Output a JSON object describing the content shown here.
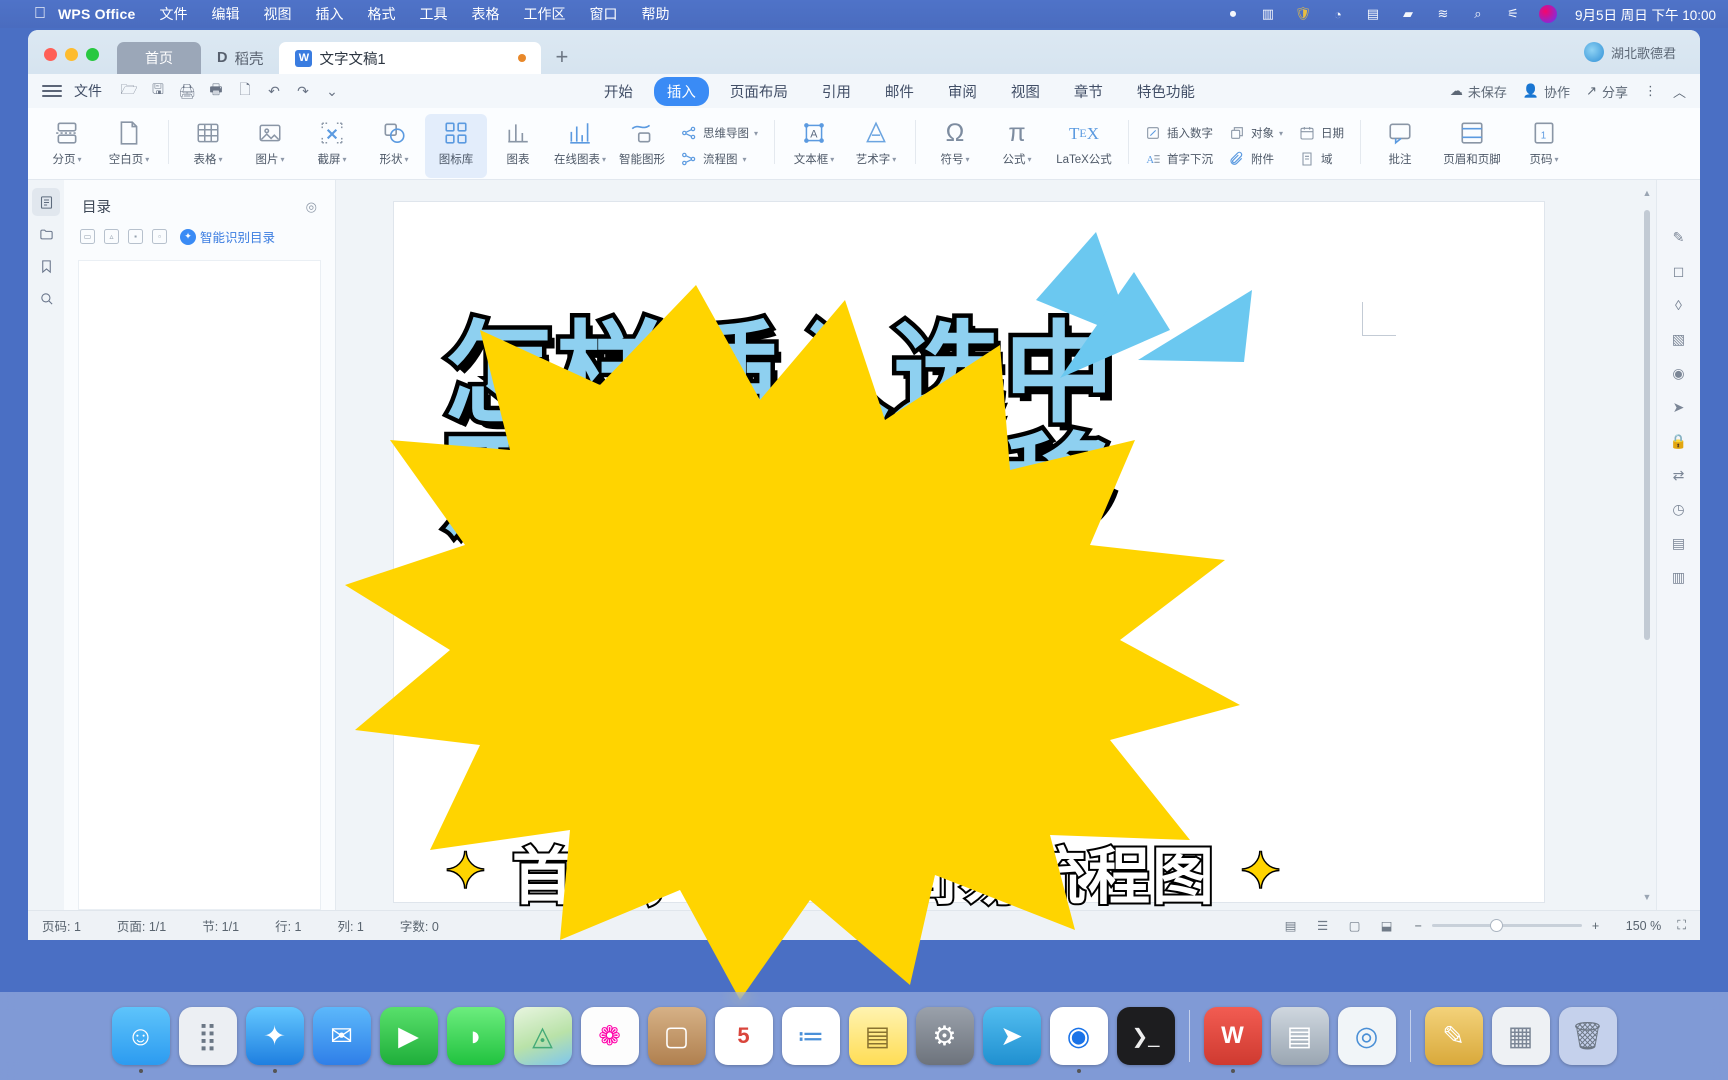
{
  "mac_menu": {
    "apple": "",
    "items": [
      "WPS Office",
      "文件",
      "编辑",
      "视图",
      "插入",
      "格式",
      "工具",
      "表格",
      "工作区",
      "窗口",
      "帮助"
    ],
    "status_icons": [
      "record-icon",
      "screen-icon",
      "shield-icon",
      "clock-icon",
      "book-icon",
      "battery-icon",
      "wifi-icon",
      "search-icon",
      "control-center-icon",
      "siri-icon"
    ],
    "clock": "9月5日 周日 下午 10:00"
  },
  "window": {
    "tabs": [
      {
        "label": "首页",
        "name": "tab-home"
      },
      {
        "label": "稻壳",
        "name": "tab-docer"
      },
      {
        "label": "文字文稿1",
        "name": "tab-document"
      }
    ],
    "new_tab": "+",
    "account": "湖北歌德君"
  },
  "ribbon": {
    "quick_access": [
      "open-icon",
      "save-icon",
      "print-icon",
      "print-preview-icon",
      "export-pdf-icon",
      "undo-icon",
      "redo-icon",
      "more-icon"
    ],
    "file_label": "文件",
    "tabs": [
      {
        "label": "开始",
        "active": false
      },
      {
        "label": "插入",
        "active": true
      },
      {
        "label": "页面布局",
        "active": false
      },
      {
        "label": "引用",
        "active": false
      },
      {
        "label": "邮件",
        "active": false
      },
      {
        "label": "审阅",
        "active": false
      },
      {
        "label": "视图",
        "active": false
      },
      {
        "label": "章节",
        "active": false
      },
      {
        "label": "特色功能",
        "active": false
      }
    ],
    "right_items": [
      {
        "label": "未保存",
        "icon": "cloud-icon"
      },
      {
        "label": "协作",
        "icon": "collab-icon"
      },
      {
        "label": "分享",
        "icon": "share-icon"
      }
    ],
    "more_label": "⋮",
    "collapse_label": "︿",
    "groups": [
      {
        "name": "pages",
        "buttons": [
          {
            "label": "分页",
            "icon": "page-break-icon",
            "caret": true
          },
          {
            "label": "空白页",
            "icon": "blank-page-icon",
            "caret": true
          }
        ]
      },
      {
        "name": "illustrations",
        "buttons": [
          {
            "label": "表格",
            "icon": "table-icon",
            "caret": true
          },
          {
            "label": "图片",
            "icon": "picture-icon",
            "caret": true
          },
          {
            "label": "截屏",
            "icon": "screenshot-icon",
            "caret": true
          },
          {
            "label": "形状",
            "icon": "shapes-icon",
            "caret": true
          },
          {
            "label": "图标库",
            "icon": "icon-library-icon",
            "selected": true
          },
          {
            "label": "图表",
            "icon": "chart-icon"
          },
          {
            "label": "在线图表",
            "icon": "online-chart-icon",
            "caret": true
          },
          {
            "label": "智能图形",
            "icon": "smart-graphic-icon"
          }
        ]
      },
      {
        "name": "diagrams",
        "stacked": [
          {
            "label": "思维导图",
            "icon": "mindmap-icon",
            "caret": true
          },
          {
            "label": "流程图",
            "icon": "flowchart-icon",
            "caret": true
          }
        ]
      },
      {
        "name": "text",
        "buttons": [
          {
            "label": "文本框",
            "icon": "textbox-icon",
            "caret": true
          },
          {
            "label": "艺术字",
            "icon": "wordart-icon",
            "caret": true
          }
        ]
      },
      {
        "name": "symbols",
        "buttons": [
          {
            "label": "符号",
            "icon": "omega-icon",
            "caret": true
          },
          {
            "label": "公式",
            "icon": "pi-icon",
            "caret": true
          },
          {
            "label": "LaTeX公式",
            "icon": "latex-icon"
          }
        ]
      },
      {
        "name": "insert-misc",
        "stacked": [
          {
            "label": "插入数字",
            "icon": "insert-number-icon"
          },
          {
            "label": "首字下沉",
            "icon": "drop-cap-icon"
          }
        ]
      },
      {
        "name": "object",
        "stacked": [
          {
            "label": "对象",
            "icon": "object-icon",
            "caret": true
          },
          {
            "label": "附件",
            "icon": "attachment-icon"
          }
        ]
      },
      {
        "name": "date-field",
        "stacked": [
          {
            "label": "日期",
            "icon": "date-icon"
          },
          {
            "label": "域",
            "icon": "field-icon"
          }
        ]
      },
      {
        "name": "comment",
        "buttons": [
          {
            "label": "批注",
            "icon": "comment-icon"
          },
          {
            "label": "页眉和页脚",
            "icon": "header-footer-icon"
          },
          {
            "label": "页码",
            "icon": "page-number-icon",
            "caret": true
          }
        ]
      }
    ]
  },
  "left_rail": [
    {
      "icon": "outline-icon",
      "name": "rail-outline",
      "selected": true
    },
    {
      "icon": "folder-icon",
      "name": "rail-folder",
      "selected": false
    },
    {
      "icon": "bookmark-icon",
      "name": "rail-bookmark",
      "selected": false
    },
    {
      "icon": "search-icon",
      "name": "rail-search",
      "selected": false
    }
  ],
  "nav_panel": {
    "title": "目录",
    "gear": "settings-icon",
    "level_buttons": [
      "level-1-icon",
      "level-2-icon",
      "level-3-icon",
      "level-4-icon"
    ],
    "ai_label": "智能识别目录"
  },
  "right_rail": [
    "pen-icon",
    "shapes-icon",
    "eraser-icon",
    "picture-icon",
    "stamp-icon",
    "cursor-icon",
    "lock-icon",
    "align-icon",
    "history-icon",
    "export-icon",
    "summary-icon"
  ],
  "document": {
    "title_lines": [
      "怎样插入选中",
      "形状，整体移",
      "动?"
    ],
    "subtitle": "首先，画一个简易流程图",
    "subtitle_sparkle": "✦",
    "colors": {
      "burst": "#FFD400",
      "title_fill": "#8ED0F0",
      "title_outline": "#000000",
      "rays": "#6BC8F0"
    }
  },
  "status_bar": {
    "items": [
      "页码: 1",
      "页面: 1/1",
      "节: 1/1",
      "行: 1",
      "列: 1",
      "字数: 0"
    ],
    "view_modes": [
      "page-view-icon",
      "outline-view-icon",
      "web-view-icon",
      "focus-icon"
    ],
    "zoom_out": "−",
    "zoom_in": "+",
    "zoom_level": "150 %",
    "fullscreen": "fullscreen-icon"
  },
  "dock": {
    "apps": [
      {
        "name": "finder",
        "glyph": "☺",
        "color": "#2c9bf0"
      },
      {
        "name": "launchpad",
        "glyph": "⠿",
        "color": "#dfe3e8"
      },
      {
        "name": "safari",
        "glyph": "✦",
        "color": "#2ea6f7"
      },
      {
        "name": "mail",
        "glyph": "✉",
        "color": "#3b9df5"
      },
      {
        "name": "facetime",
        "glyph": "▶",
        "color": "#36c24b"
      },
      {
        "name": "messages",
        "glyph": "◗",
        "color": "#43d158"
      },
      {
        "name": "maps",
        "glyph": "▲",
        "color": "#f0f3f6"
      },
      {
        "name": "photos",
        "glyph": "❁",
        "color": "#fafafa"
      },
      {
        "name": "contacts",
        "glyph": "▢",
        "color": "#c49a6c"
      },
      {
        "name": "calendar",
        "glyph": "5",
        "color": "#ffffff"
      },
      {
        "name": "reminders",
        "glyph": "≔",
        "color": "#ffffff"
      },
      {
        "name": "notes",
        "glyph": "▤",
        "color": "#ffe27a"
      },
      {
        "name": "settings",
        "glyph": "⚙",
        "color": "#8a8f98"
      },
      {
        "name": "telegram",
        "glyph": "➤",
        "color": "#39a9e8"
      },
      {
        "name": "chrome",
        "glyph": "◉",
        "color": "#ffffff"
      },
      {
        "name": "terminal",
        "glyph": "❯",
        "color": "#1c1c1c"
      },
      {
        "name": "wps-office",
        "glyph": "W",
        "color": "#d9453c"
      },
      {
        "name": "scanner",
        "glyph": "▤",
        "color": "#b9c2cc"
      },
      {
        "name": "preview",
        "glyph": "◎",
        "color": "#e9eef3"
      },
      {
        "name": "sketch",
        "glyph": "✎",
        "color": "#e5b94e"
      },
      {
        "name": "screenshots",
        "glyph": "▦",
        "color": "#e8eaed"
      },
      {
        "name": "trash",
        "glyph": "🗑",
        "color": "#dfe5ea"
      }
    ]
  }
}
